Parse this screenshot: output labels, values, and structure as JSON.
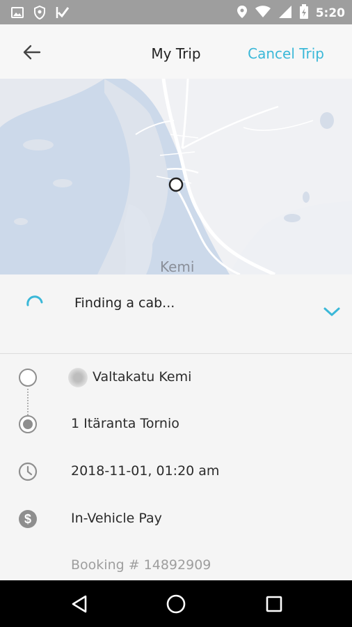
{
  "status_bar": {
    "time": "5:20",
    "left_icons": [
      "image-icon",
      "shield-icon",
      "check-flag-icon"
    ],
    "right_icons": [
      "location-icon",
      "wifi-icon",
      "signal-icon",
      "battery-charging-icon"
    ]
  },
  "header": {
    "title": "My Trip",
    "cancel_label": "Cancel Trip",
    "back_icon": "arrow-left-icon"
  },
  "map": {
    "city_label": "Kemi"
  },
  "trip_status": {
    "text": "Finding a cab...",
    "accent_color": "#3bb8d8"
  },
  "trip": {
    "pickup": "Valtakatu Kemi",
    "dropoff": "1 Itäranta Tornio",
    "datetime": "2018-11-01, 01:20 am",
    "payment": "In-Vehicle Pay",
    "booking": "Booking # 14892909"
  },
  "nav_bar": {
    "buttons": [
      "back-triangle-icon",
      "home-circle-icon",
      "recents-square-icon"
    ]
  }
}
